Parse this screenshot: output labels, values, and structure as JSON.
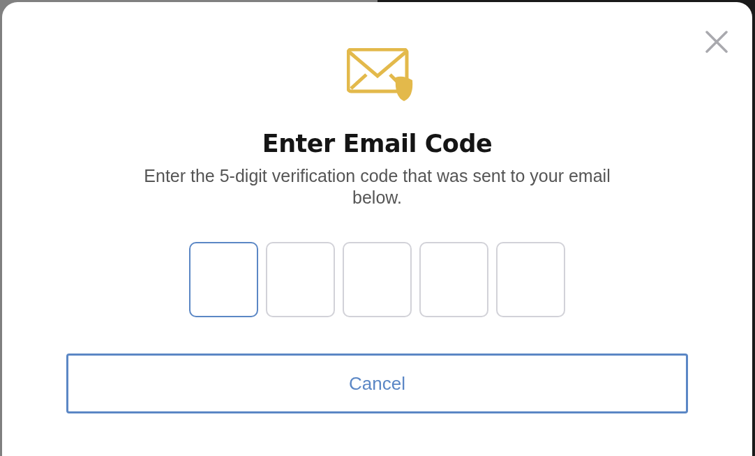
{
  "dialog": {
    "title": "Enter Email Code",
    "message": "Enter the 5-digit verification code that was sent to your email below.",
    "code_boxes": [
      {
        "selected": true
      },
      {
        "selected": false
      },
      {
        "selected": false
      },
      {
        "selected": false
      },
      {
        "selected": false
      }
    ],
    "cancel_button": "Cancel"
  }
}
